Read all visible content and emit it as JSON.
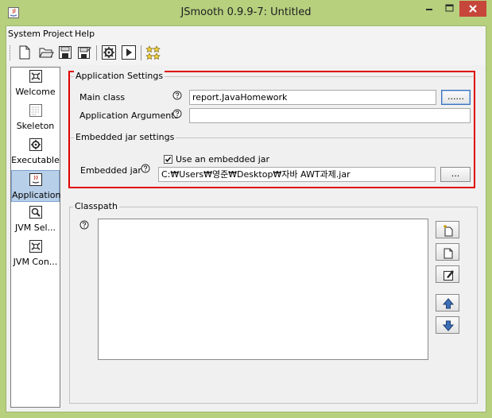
{
  "window": {
    "title": "JSmooth 0.9.9-7: Untitled"
  },
  "menu": [
    {
      "label": "System"
    },
    {
      "label": "Project"
    },
    {
      "label": "Help"
    }
  ],
  "toolbar": {
    "buttons": [
      {
        "icon": "new-file-icon"
      },
      {
        "icon": "open-folder-icon"
      },
      {
        "icon": "save-icon"
      },
      {
        "icon": "save-as-icon"
      },
      {
        "icon": "compile-gear-icon"
      },
      {
        "icon": "run-icon"
      },
      {
        "icon": "wizard-stars-icon"
      }
    ]
  },
  "sidebar": {
    "items": [
      {
        "label": "Welcome",
        "icon": "welcome-icon"
      },
      {
        "label": "Skeleton",
        "icon": "skeleton-icon"
      },
      {
        "label": "Executable",
        "icon": "executable-gear-icon"
      },
      {
        "label": "Application",
        "icon": "application-icon",
        "active": true
      },
      {
        "label": "JVM Sel...",
        "icon": "jvm-select-icon"
      },
      {
        "label": "JVM Con...",
        "icon": "jvm-config-icon"
      }
    ]
  },
  "application_settings": {
    "title": "Application Settings",
    "main_class_label": "Main class",
    "main_class_value": "report.JavaHomework",
    "browse_label": "......",
    "arguments_label": "Application Arguments",
    "arguments_value": ""
  },
  "embedded_jar": {
    "title": "Embedded jar settings",
    "checkbox_label": "Use an embedded jar",
    "checked": true,
    "jar_label": "Embedded jar",
    "jar_path": "C:₩Users₩영준₩Desktop₩자바 AWT과제.jar",
    "browse_label": "..."
  },
  "classpath": {
    "title": "Classpath",
    "buttons": [
      {
        "icon": "add-entry-icon"
      },
      {
        "icon": "new-entry-icon"
      },
      {
        "icon": "edit-entry-icon"
      },
      {
        "icon": "move-up-icon"
      },
      {
        "icon": "move-down-icon"
      }
    ]
  },
  "colors": {
    "title_bar": "#b6d07e",
    "close_button": "#c7463b",
    "highlight_border": "#e00000",
    "active_nav": "#b8cfe9"
  }
}
